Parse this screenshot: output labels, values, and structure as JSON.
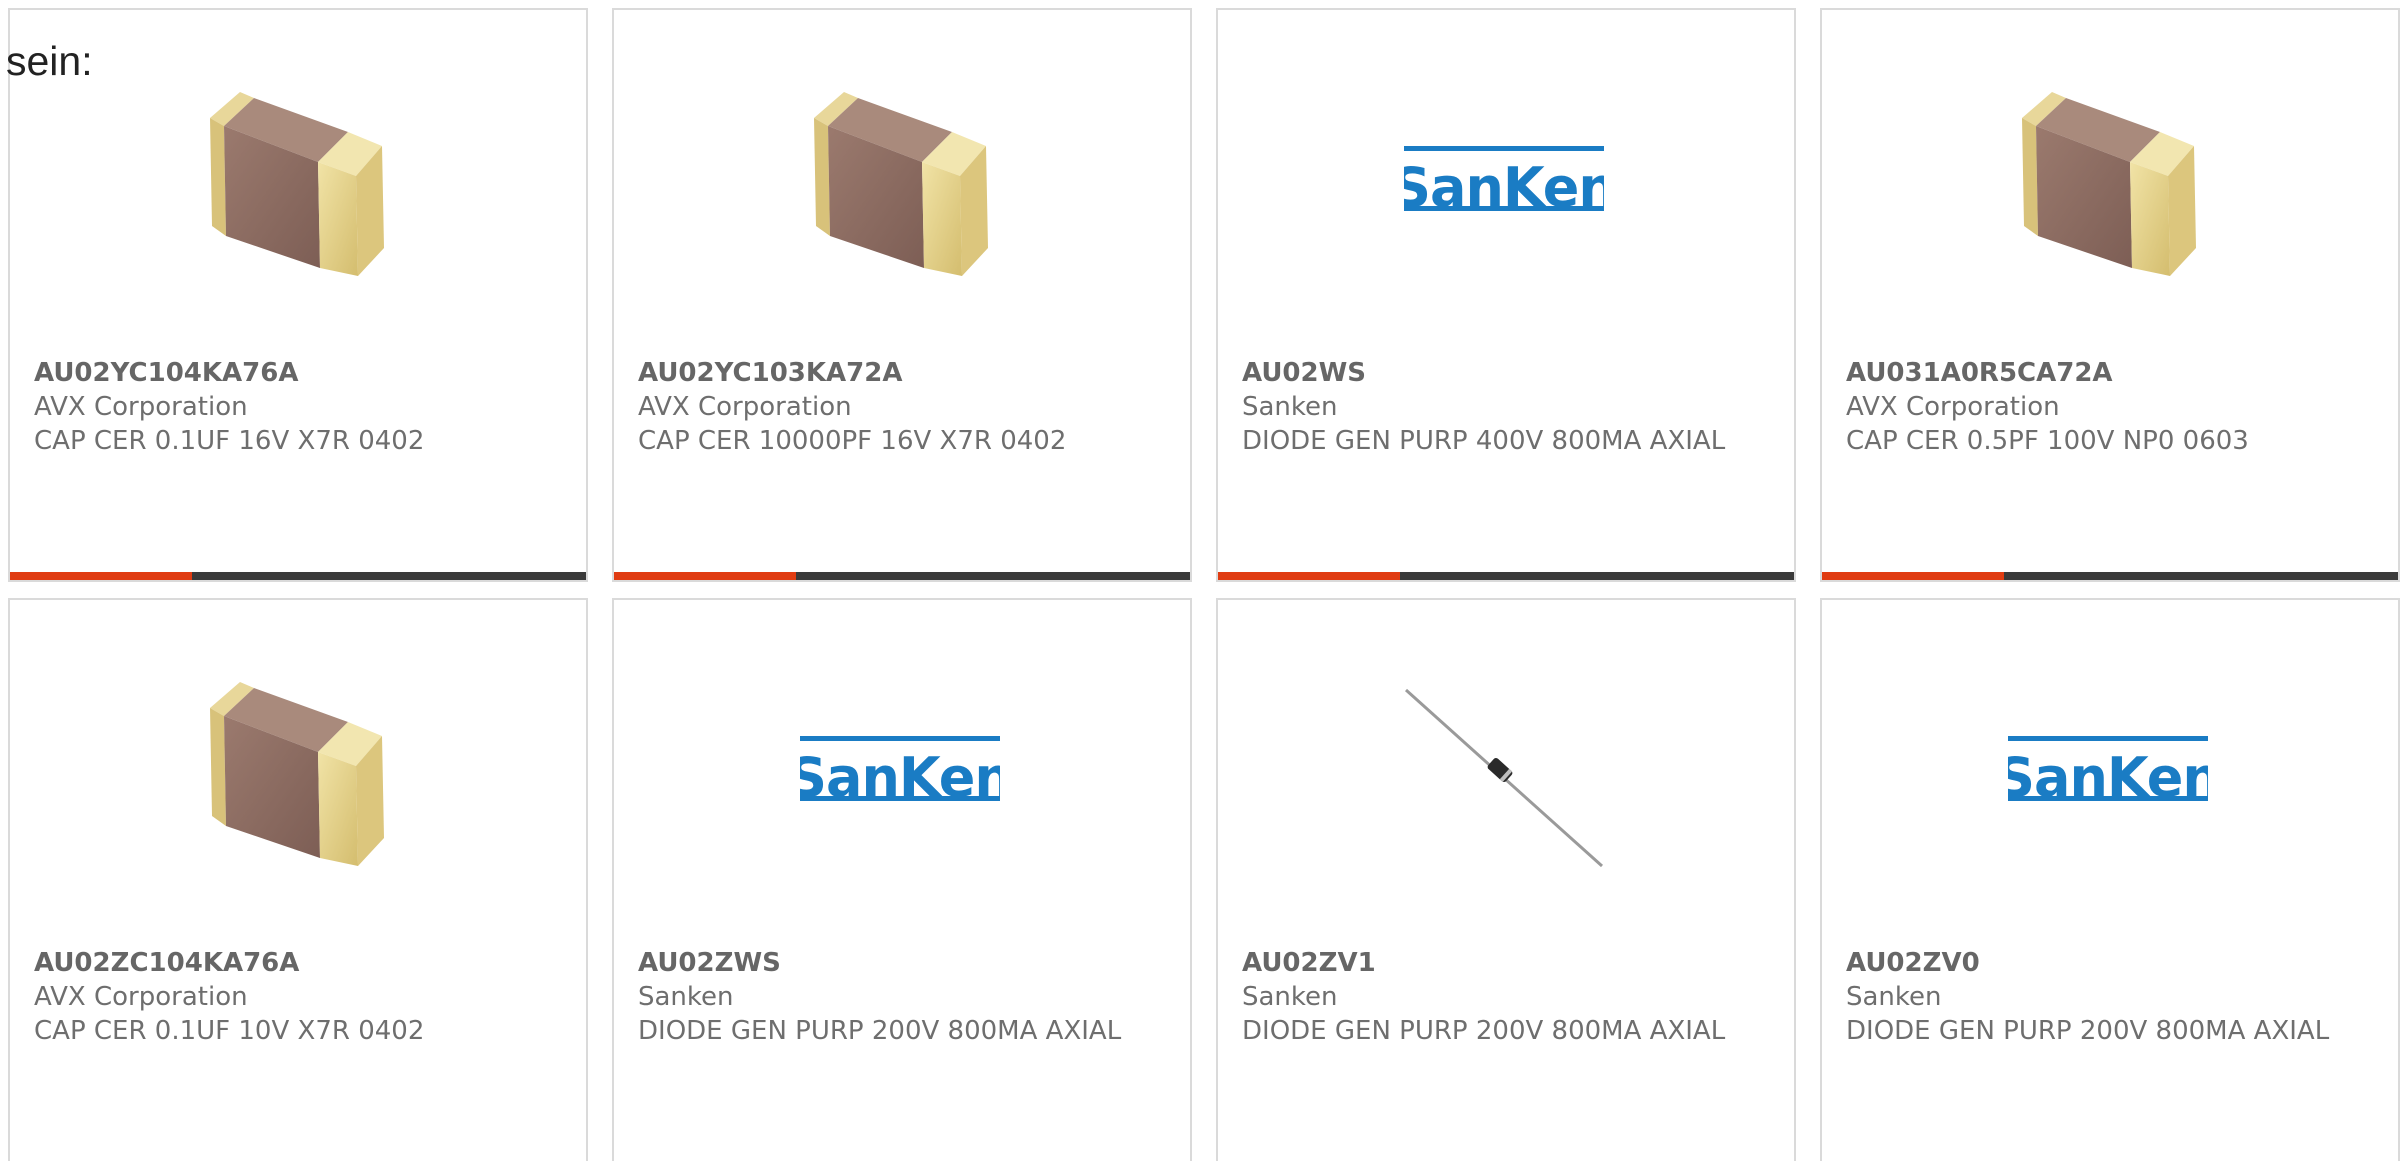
{
  "intro": {
    "text": "sein:"
  },
  "colors": {
    "accent": "#e03c12",
    "bar": "#3a3a3a",
    "sanken_blue": "#1a7cc4",
    "text": "#6e6e6e"
  },
  "products": [
    {
      "part_number": "AU02YC104KA76A",
      "manufacturer": "AVX Corporation",
      "description": "CAP CER 0.1UF 16V X7R 0402",
      "image": "capacitor-chip-icon"
    },
    {
      "part_number": "AU02YC103KA72A",
      "manufacturer": "AVX Corporation",
      "description": "CAP CER 10000PF 16V X7R 0402",
      "image": "capacitor-chip-icon"
    },
    {
      "part_number": "AU02WS",
      "manufacturer": "Sanken",
      "description": "DIODE GEN PURP 400V 800MA AXIAL",
      "image": "sanken-logo"
    },
    {
      "part_number": "AU031A0R5CA72A",
      "manufacturer": "AVX Corporation",
      "description": "CAP CER 0.5PF 100V NP0 0603",
      "image": "capacitor-chip-icon"
    },
    {
      "part_number": "AU02ZC104KA76A",
      "manufacturer": "AVX Corporation",
      "description": "CAP CER 0.1UF 10V X7R 0402",
      "image": "capacitor-chip-icon"
    },
    {
      "part_number": "AU02ZWS",
      "manufacturer": "Sanken",
      "description": "DIODE GEN PURP 200V 800MA AXIAL",
      "image": "sanken-logo"
    },
    {
      "part_number": "AU02ZV1",
      "manufacturer": "Sanken",
      "description": "DIODE GEN PURP 200V 800MA AXIAL",
      "image": "axial-diode-icon"
    },
    {
      "part_number": "AU02ZV0",
      "manufacturer": "Sanken",
      "description": "DIODE GEN PURP 200V 800MA AXIAL",
      "image": "sanken-logo"
    }
  ],
  "logo": {
    "sanken_text": "SanKen"
  }
}
